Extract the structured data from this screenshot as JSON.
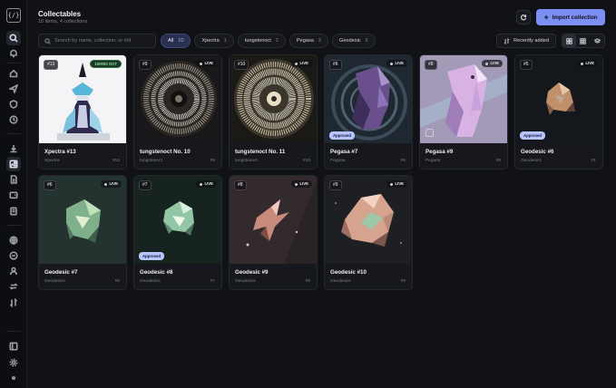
{
  "app": {
    "logo": "{/}"
  },
  "header": {
    "title": "Collectables",
    "subtitle": "10 items, 4 collections",
    "import_label": "Import collection"
  },
  "search": {
    "placeholder": "Search by name, collection, or #id",
    "value": ""
  },
  "filters": [
    {
      "label": "All",
      "count": "10",
      "active": true
    },
    {
      "label": "Xpectra",
      "count": "1",
      "active": false
    },
    {
      "label": "tungstenoct",
      "count": "2",
      "active": false
    },
    {
      "label": "Pegasa",
      "count": "2",
      "active": false
    },
    {
      "label": "Geodesic",
      "count": "5",
      "active": false
    }
  ],
  "sort": {
    "label": "Recently added"
  },
  "view": {
    "active": "grid-large"
  },
  "badges": {
    "live": "LIVE",
    "approved": "Approved"
  },
  "colors": {
    "accent": "#7c8ff2",
    "approved_badge": "#b6c5ff",
    "price_badge": "#8fe3a6"
  },
  "sidebar": {
    "icons": [
      "search-icon",
      "bell-icon",
      "home-icon",
      "send-icon",
      "shield-icon",
      "clock-icon",
      "download-icon",
      "image-icon",
      "file-icon",
      "wallet-icon",
      "ticket-icon",
      "globe-icon",
      "circle-minus-icon",
      "user-icon",
      "swap-icon",
      "exchange-icon",
      "panel-icon",
      "settings-icon",
      "dot-icon"
    ],
    "active": "image-icon"
  },
  "items": [
    {
      "num": "#13",
      "name": "Xpectra #13",
      "collection": "Xpectra",
      "id": "#13",
      "live": false,
      "price": "100000 OCT",
      "approved": false
    },
    {
      "num": "#9",
      "name": "tungstenoct No. 10",
      "collection": "tungstenoct",
      "id": "#9",
      "live": true,
      "price": "",
      "approved": false
    },
    {
      "num": "#10",
      "name": "tungstenoct No. 11",
      "collection": "tungstenoct",
      "id": "#10",
      "live": true,
      "price": "",
      "approved": false
    },
    {
      "num": "#6",
      "name": "Pegasa #7",
      "collection": "Pegasa",
      "id": "#6",
      "live": true,
      "price": "",
      "approved": true
    },
    {
      "num": "#8",
      "name": "Pegasa #9",
      "collection": "Pegasa",
      "id": "#8",
      "live": true,
      "price": "",
      "approved": false
    },
    {
      "num": "#5",
      "name": "Geodesic #6",
      "collection": "Geodesics",
      "id": "#1",
      "live": true,
      "price": "",
      "approved": true
    },
    {
      "num": "#6",
      "name": "Geodesic #7",
      "collection": "Geodesics",
      "id": "#6",
      "live": true,
      "price": "",
      "approved": false
    },
    {
      "num": "#7",
      "name": "Geodesic #8",
      "collection": "Geodesics",
      "id": "#7",
      "live": true,
      "price": "",
      "approved": true
    },
    {
      "num": "#8",
      "name": "Geodesic #9",
      "collection": "Geodesics",
      "id": "#8",
      "live": true,
      "price": "",
      "approved": false
    },
    {
      "num": "#9",
      "name": "Geodesic #10",
      "collection": "Geodesics",
      "id": "#9",
      "live": true,
      "price": "",
      "approved": false
    }
  ]
}
